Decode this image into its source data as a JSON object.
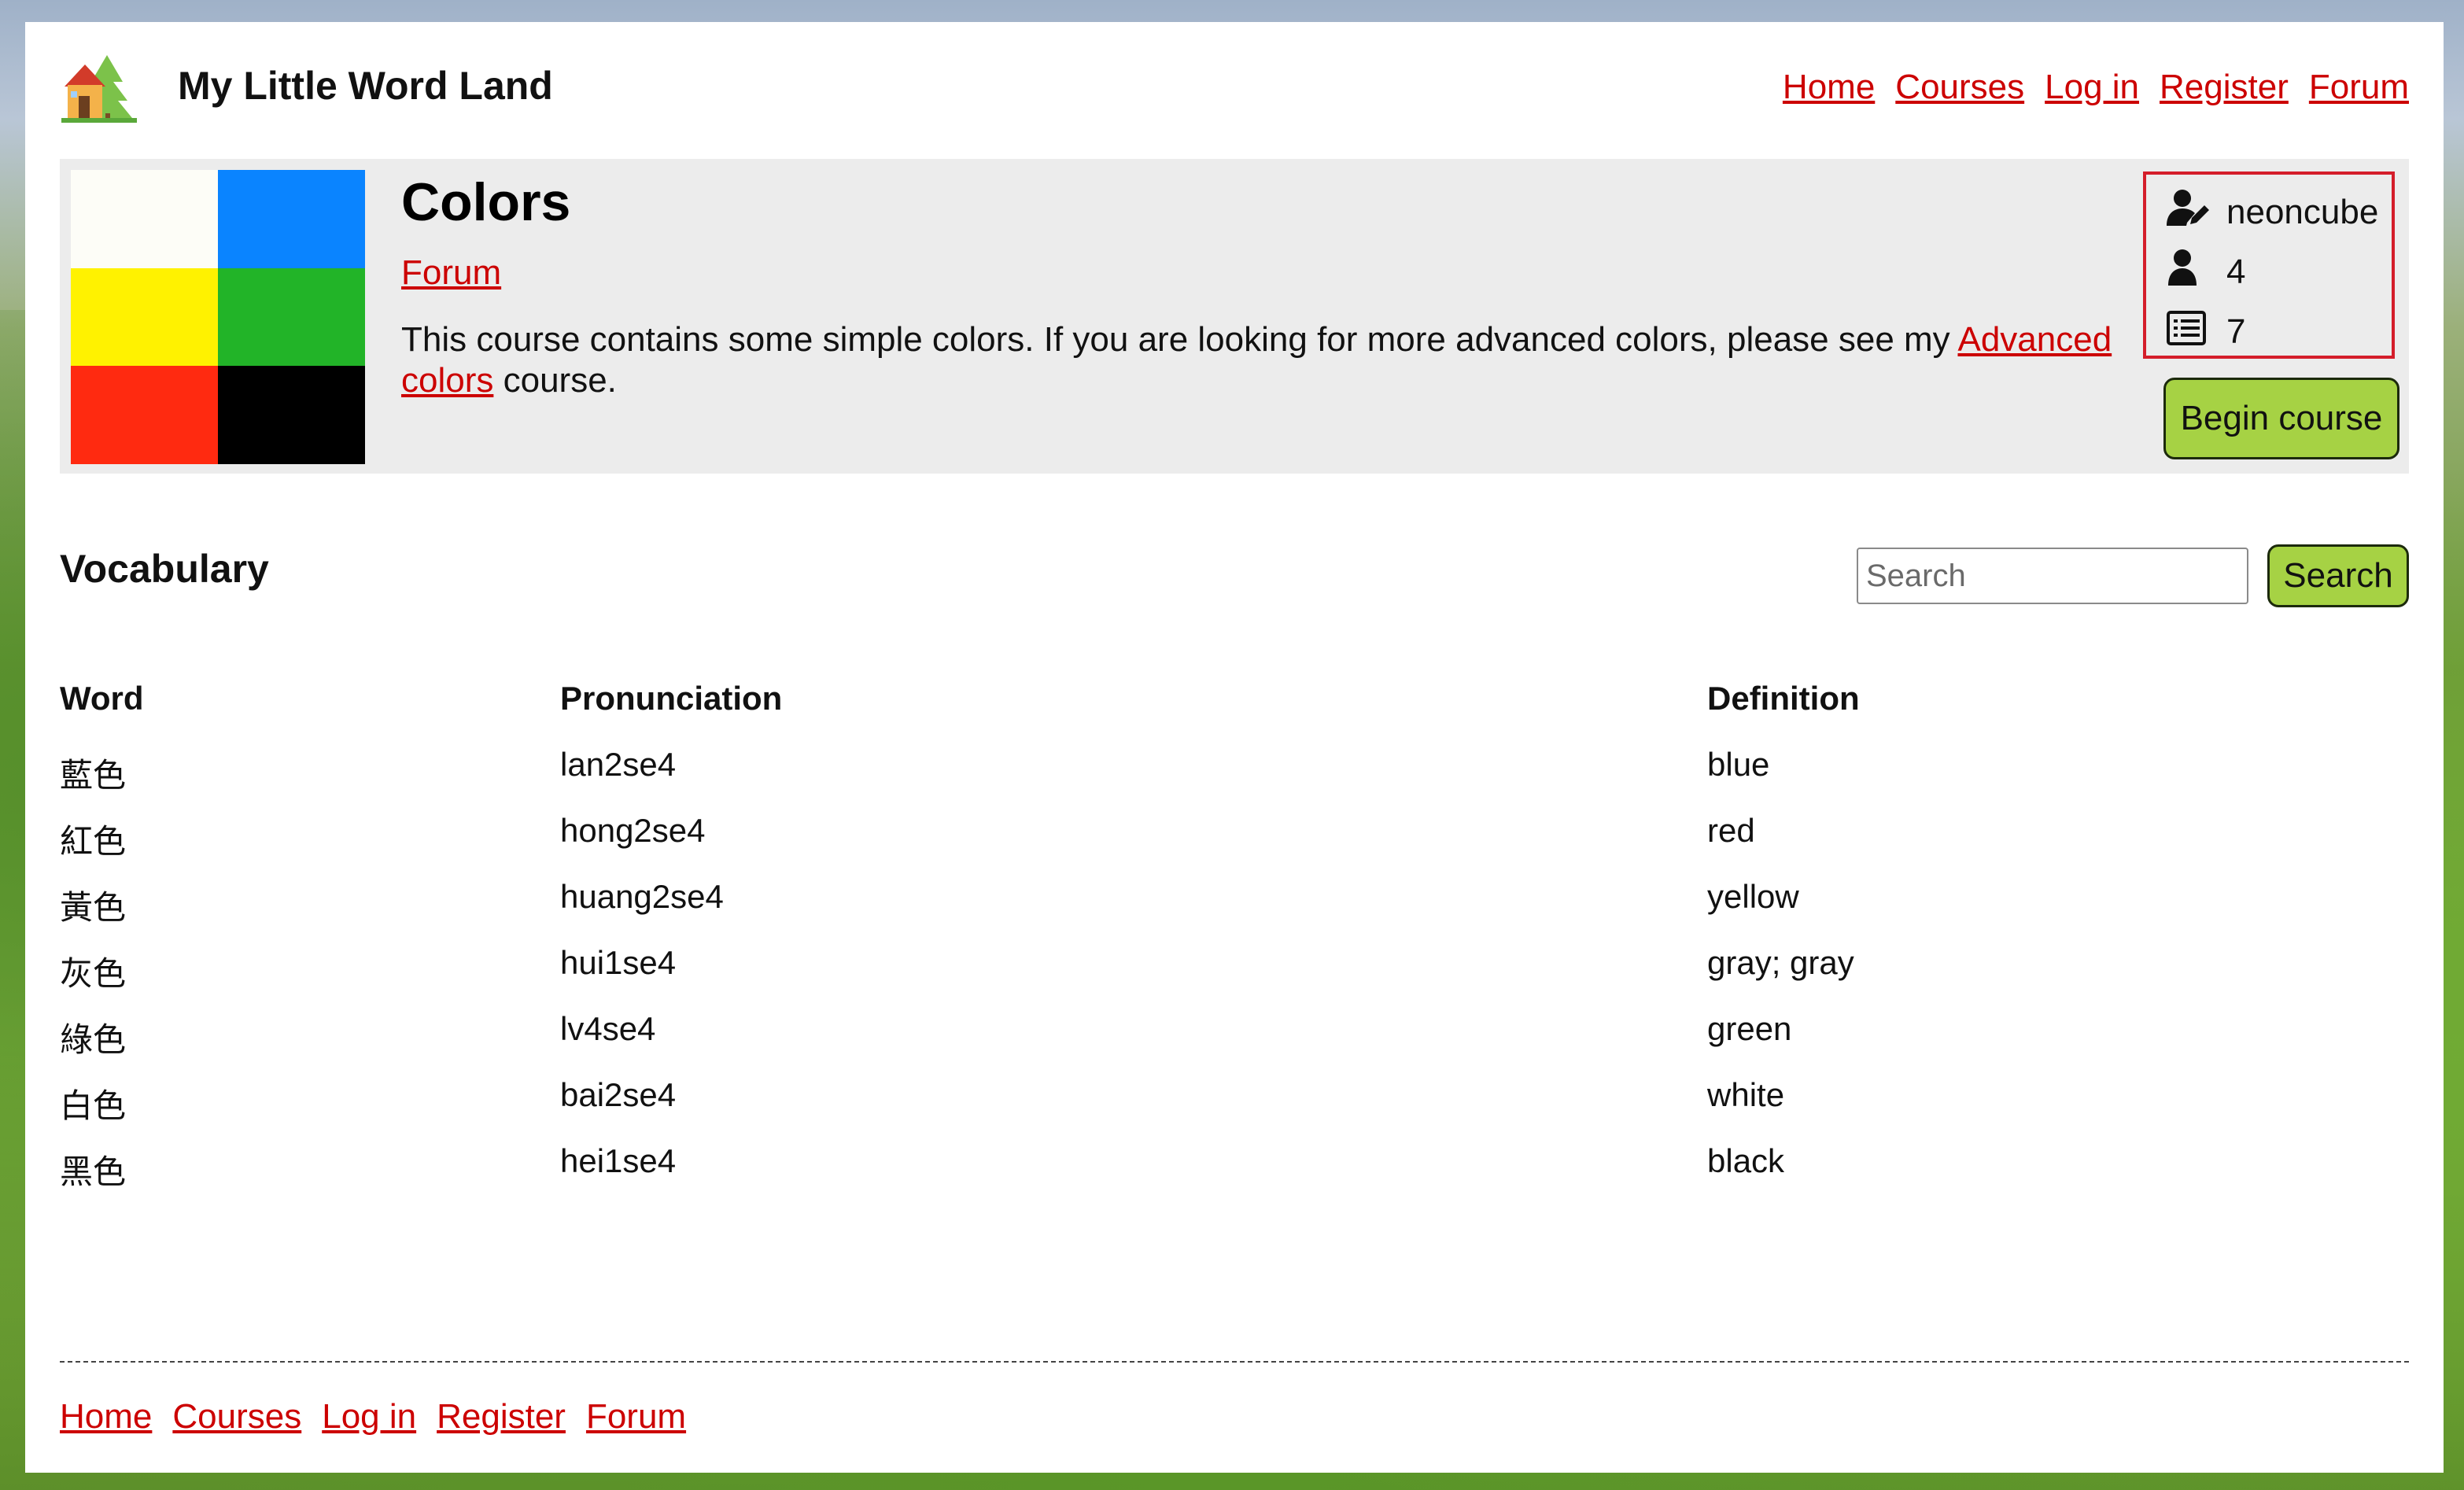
{
  "header": {
    "site_title": "My Little Word Land",
    "logo_icon": "house-icon",
    "nav": [
      "Home",
      "Courses",
      "Log in",
      "Register",
      "Forum"
    ]
  },
  "course": {
    "title": "Colors",
    "forum_link": "Forum",
    "description_before": "This course contains some simple colors. If you are looking for more advanced colors, please see my ",
    "description_link": "Advanced colors",
    "description_after": " course.",
    "swatch_colors": [
      "#fdfdf7",
      "#0a84ff",
      "#fff200",
      "#22b428",
      "#ff2a10",
      "#000000"
    ],
    "stats": {
      "author": "neoncube",
      "learners": "4",
      "word_count": "7"
    },
    "begin_button": "Begin course"
  },
  "vocabulary": {
    "title": "Vocabulary",
    "search_placeholder": "Search",
    "search_button": "Search",
    "columns": [
      "Word",
      "Pronunciation",
      "Definition"
    ],
    "rows": [
      {
        "word": "藍色",
        "pronunciation": "lan2se4",
        "definition": "blue"
      },
      {
        "word": "紅色",
        "pronunciation": "hong2se4",
        "definition": "red"
      },
      {
        "word": "黃色",
        "pronunciation": "huang2se4",
        "definition": "yellow"
      },
      {
        "word": "灰色",
        "pronunciation": "hui1se4",
        "definition": "gray; gray"
      },
      {
        "word": "綠色",
        "pronunciation": "lv4se4",
        "definition": "green"
      },
      {
        "word": "白色",
        "pronunciation": "bai2se4",
        "definition": "white"
      },
      {
        "word": "黑色",
        "pronunciation": "hei1se4",
        "definition": "black"
      }
    ]
  },
  "footer": {
    "nav": [
      "Home",
      "Courses",
      "Log in",
      "Register",
      "Forum"
    ]
  },
  "colors": {
    "link": "#cc0000",
    "button": "#a6d244",
    "banner_bg": "#ececec",
    "stats_border": "#d41d2a"
  }
}
